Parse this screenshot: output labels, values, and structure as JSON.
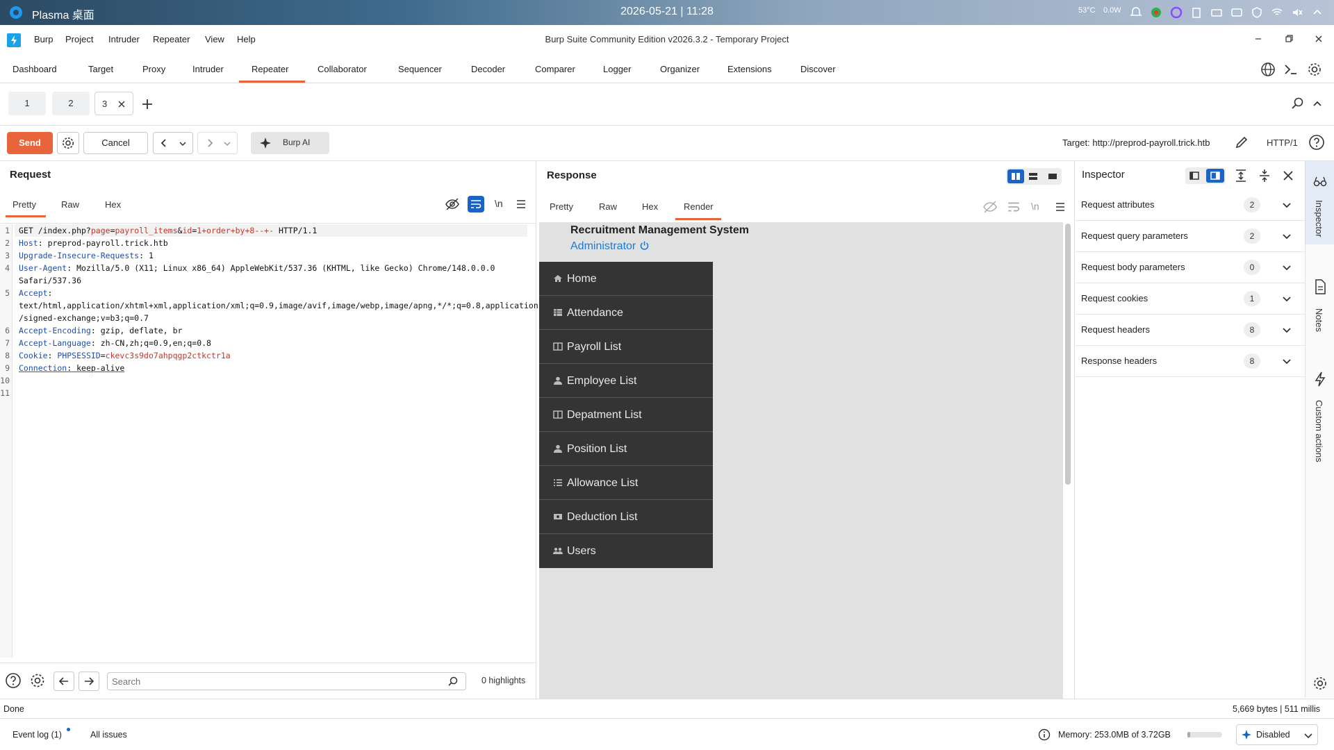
{
  "taskbar": {
    "plasma_label": "Plasma 桌面",
    "clock": "2026-05-21 | 11:28",
    "temp": "53°C",
    "power": "0.0W"
  },
  "menubar": {
    "items": [
      "Burp",
      "Project",
      "Intruder",
      "Repeater",
      "View",
      "Help"
    ],
    "window_title": "Burp Suite Community Edition v2026.3.2 - Temporary Project"
  },
  "main_tabs": [
    "Dashboard",
    "Target",
    "Proxy",
    "Intruder",
    "Repeater",
    "Collaborator",
    "Sequencer",
    "Decoder",
    "Comparer",
    "Logger",
    "Organizer",
    "Extensions",
    "Discover"
  ],
  "repeater_tabs": [
    "1",
    "2",
    "3"
  ],
  "toolbar": {
    "send": "Send",
    "cancel": "Cancel",
    "burp_ai": "Burp AI",
    "target_label": "Target: http://preprod-payroll.trick.htb",
    "http_version": "HTTP/1"
  },
  "request": {
    "title": "Request",
    "tabs": [
      "Pretty",
      "Raw",
      "Hex"
    ],
    "newline_toggle": "\\n",
    "line_numbers": [
      "1",
      "2",
      "3",
      "4",
      "",
      "5",
      "",
      "",
      "6",
      "7",
      "8",
      "9",
      "10",
      "11"
    ],
    "line1": {
      "method": "GET /index.php?",
      "p1": "page",
      "eq1": "=",
      "v1": "payroll_items",
      "amp": "&",
      "p2": "id",
      "eq2": "=",
      "v2": "1+order+by+8--+-",
      "proto": " HTTP/1.1"
    },
    "headers": [
      {
        "name": "Host",
        "value": " preprod-payroll.trick.htb"
      },
      {
        "name": "Upgrade-Insecure-Requests",
        "value": " 1"
      },
      {
        "name": "User-Agent",
        "value": " Mozilla/5.0 (X11; Linux x86_64) AppleWebKit/537.36 (KHTML, like Gecko) Chrome/148.0.0.0"
      }
    ],
    "ua_cont": "Safari/537.36",
    "accept_name": "Accept",
    "accept_l1": "text/html,application/xhtml+xml,application/xml;q=0.9,image/avif,image/webp,image/apng,*/*;q=0.8,application",
    "accept_l2": "/signed-exchange;v=b3;q=0.7",
    "enc_name": "Accept-Encoding",
    "enc_value": " gzip, deflate, br",
    "lang_name": "Accept-Language",
    "lang_value": " zh-CN,zh;q=0.9,en;q=0.8",
    "cookie_name": "Cookie",
    "cookie_key": "PHPSESSID",
    "cookie_eq": "=",
    "cookie_val": "ckevc3s9do7ahpqgp2ctkctr1a",
    "conn_name": "Connection",
    "conn_value": " keep-alive",
    "search_placeholder": "Search",
    "highlights": "0 highlights"
  },
  "response": {
    "title": "Response",
    "tabs": [
      "Pretty",
      "Raw",
      "Hex",
      "Render"
    ],
    "page_heading": "Recruitment Management System",
    "admin": "Administrator",
    "nav": [
      "Home",
      "Attendance",
      "Payroll List",
      "Employee List",
      "Depatment List",
      "Position List",
      "Allowance List",
      "Deduction List",
      "Users"
    ]
  },
  "inspector": {
    "title": "Inspector",
    "rows": [
      {
        "label": "Request attributes",
        "count": "2"
      },
      {
        "label": "Request query parameters",
        "count": "2"
      },
      {
        "label": "Request body parameters",
        "count": "0"
      },
      {
        "label": "Request cookies",
        "count": "1"
      },
      {
        "label": "Request headers",
        "count": "8"
      },
      {
        "label": "Response headers",
        "count": "8"
      }
    ]
  },
  "rail": {
    "inspector": "Inspector",
    "notes": "Notes",
    "custom": "Custom actions"
  },
  "status": {
    "left": "Done",
    "right": "5,669 bytes | 511 millis"
  },
  "bottom": {
    "event_log": "Event log (1)",
    "all_issues": "All issues",
    "memory": "Memory: 253.0MB of 3.72GB",
    "memory_fraction": 0.07,
    "ai_state": "Disabled"
  },
  "colors": {
    "accent": "#e8643a",
    "blue": "#1a64c8",
    "nav_bg": "#343434",
    "render_bg": "#e1e1e1"
  }
}
